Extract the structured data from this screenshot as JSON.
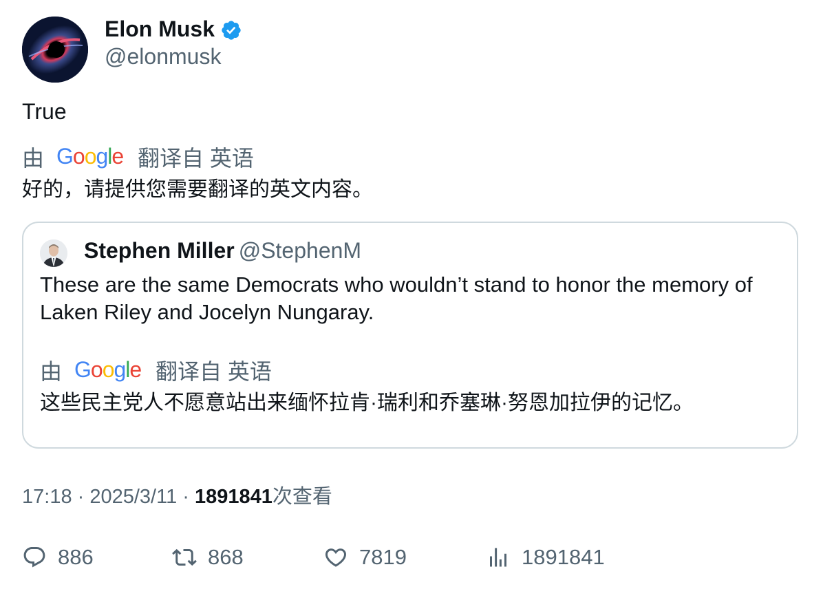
{
  "author": {
    "name": "Elon Musk",
    "handle": "@elonmusk",
    "verified_color": "#1d9bf0"
  },
  "tweet": {
    "text": "True",
    "translation": {
      "by_label": "由",
      "provider_logo": "Google",
      "translated_from": "翻译自 英语",
      "text": "好的，请提供您需要翻译的英文内容。"
    }
  },
  "quote": {
    "name": "Stephen Miller",
    "handle": "@StephenM",
    "text": "These are the same Democrats who wouldn’t stand to honor the memory of Laken Riley and Jocelyn Nungaray.",
    "translation": {
      "by_label": "由",
      "provider_logo": "Google",
      "translated_from": "翻译自 英语",
      "text": "这些民主党人不愿意站出来缅怀拉肯·瑞利和乔塞琳·努恩加拉伊的记忆。"
    }
  },
  "meta": {
    "time": "17:18",
    "sep1": " · ",
    "date": "2025/3/11",
    "sep2": " · ",
    "views_count": "1891841",
    "views_label": "次查看"
  },
  "actions": {
    "replies": "886",
    "retweets": "868",
    "likes": "7819",
    "views": "1891841"
  },
  "icons": {
    "reply": "reply-icon",
    "retweet": "retweet-icon",
    "like": "heart-icon",
    "views": "views-chart-icon",
    "verified": "verified-badge-icon"
  },
  "colors": {
    "text": "#0f1419",
    "secondary": "#536471",
    "border": "#cfd9de",
    "google_blue": "#4285f4",
    "google_red": "#ea4335",
    "google_yellow": "#fbbc05",
    "google_green": "#34a853"
  }
}
